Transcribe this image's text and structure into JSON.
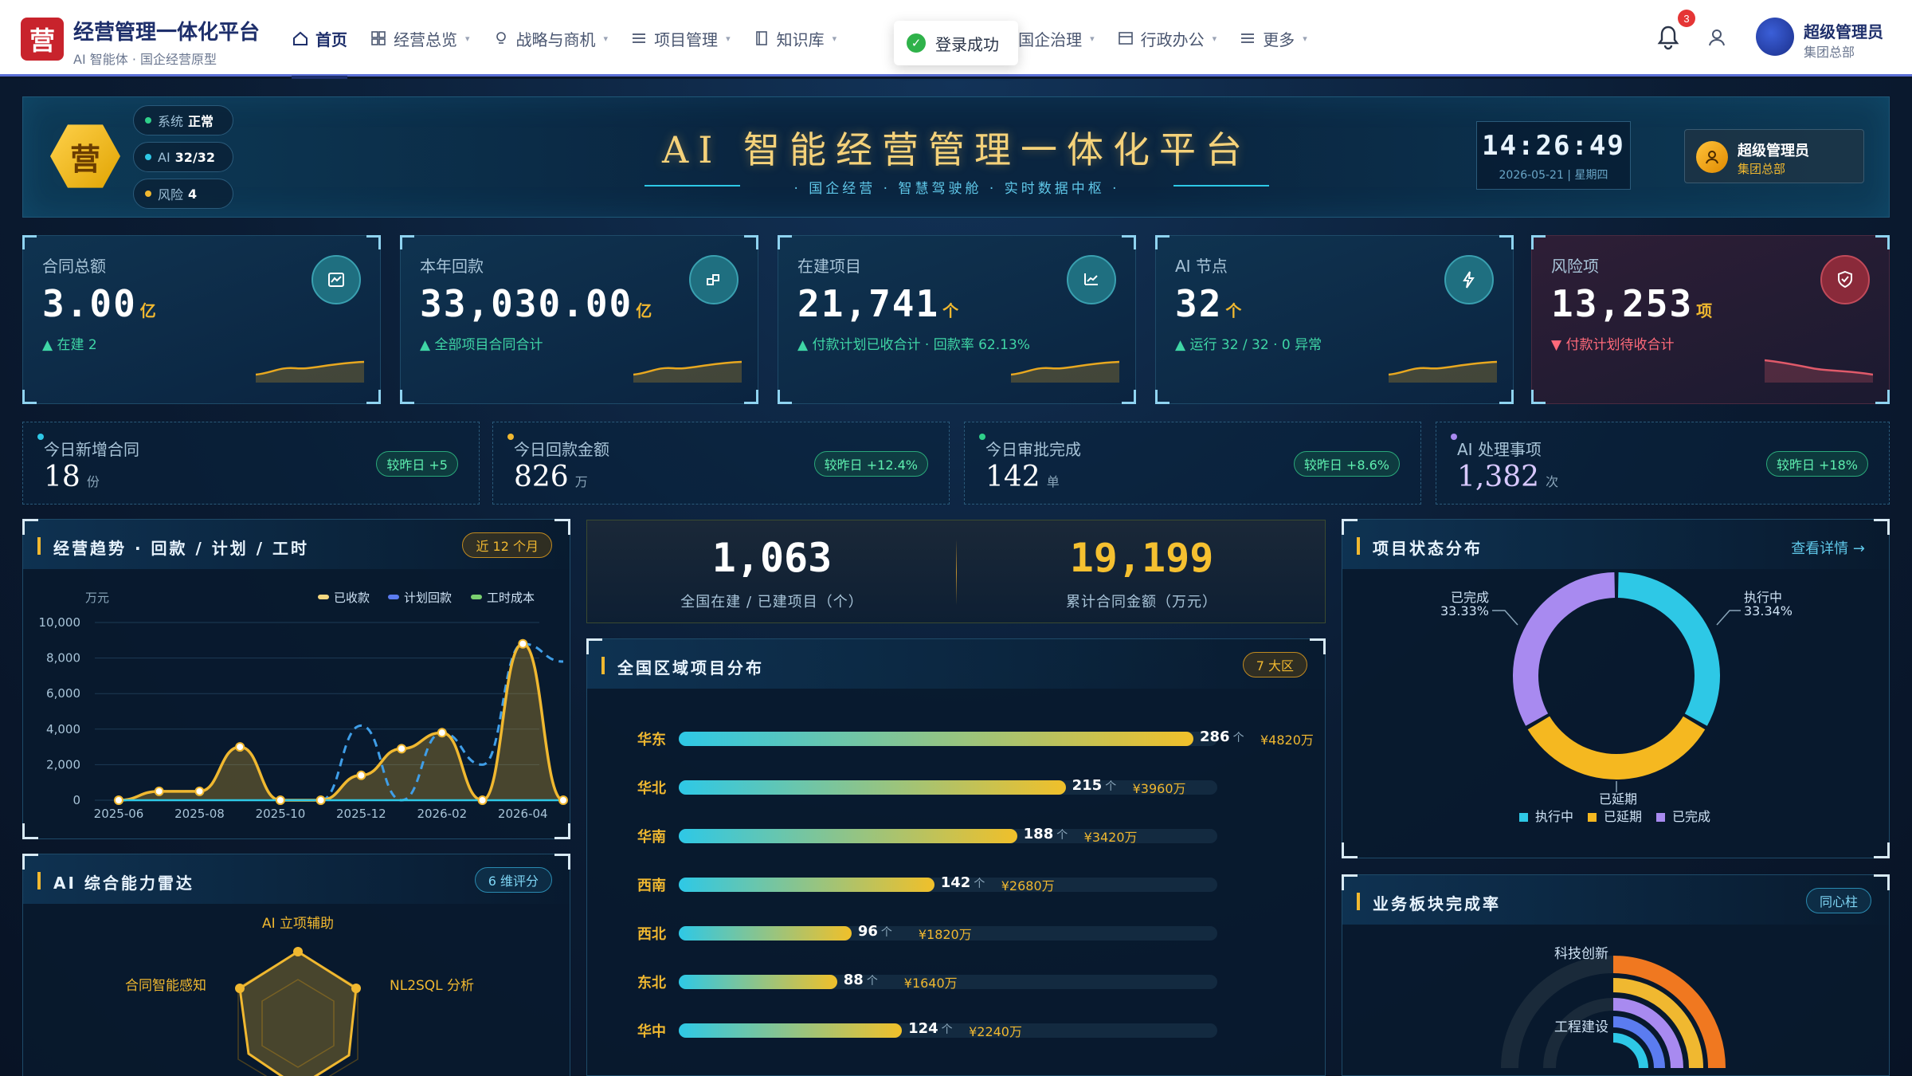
{
  "header": {
    "logo_char": "营",
    "title": "经营管理一体化平台",
    "subtitle": "AI 智能体 · 国企经营原型",
    "nav": [
      {
        "label": "首页",
        "active": true,
        "icon": "home-icon"
      },
      {
        "label": "经营总览",
        "icon": "grid-icon"
      },
      {
        "label": "战略与商机",
        "icon": "bulb-icon"
      },
      {
        "label": "项目管理",
        "icon": "list-icon"
      },
      {
        "label": "知识库",
        "icon": "book-icon"
      },
      {
        "label": "国企治理",
        "icon": "bank-icon"
      },
      {
        "label": "行政办公",
        "icon": "office-icon"
      },
      {
        "label": "更多",
        "icon": "menu-icon"
      }
    ],
    "toast": "登录成功",
    "notification_count": "3",
    "user_name": "超级管理员",
    "user_org": "集团总部"
  },
  "hero": {
    "emblem": "营",
    "title": "AI 智能经营管理一体化平台",
    "subtitle": "· 国企经营 · 智慧驾驶舱 · 实时数据中枢 ·",
    "pills": [
      {
        "label": "系统",
        "value": "正常",
        "color": "#2fd08a"
      },
      {
        "label": "AI",
        "value": "32/32",
        "color": "#2ec8e6"
      },
      {
        "label": "风险",
        "value": "4",
        "color": "#f0b830"
      }
    ],
    "time": "14:26:49",
    "date": "2026-05-21 | 星期四",
    "user_name": "超级管理员",
    "user_org": "集团总部"
  },
  "kpis": [
    {
      "label": "合同总额",
      "value": "3.00",
      "unit": "亿",
      "sub": "▲ 在建 2",
      "icon": "chart-icon"
    },
    {
      "label": "本年回款",
      "value": "33,030.00",
      "unit": "亿",
      "sub": "▲ 全部项目合同合计",
      "icon": "blocks-icon"
    },
    {
      "label": "在建项目",
      "value": "21,741",
      "unit": "个",
      "sub": "▲ 付款计划已收合计 · 回款率 62.13%",
      "icon": "trend-icon"
    },
    {
      "label": "AI 节点",
      "value": "32",
      "unit": "个",
      "sub": "▲ 运行 32 / 32 · 0 异常",
      "icon": "bolt-icon"
    },
    {
      "label": "风险项",
      "value": "13,253",
      "unit": "项",
      "sub": "▼ 付款计划待收合计",
      "icon": "shield-icon"
    }
  ],
  "minis": [
    {
      "label": "今日新增合同",
      "value": "18",
      "unit": "份",
      "tag": "较昨日 +5",
      "dot": "#2ec8e6"
    },
    {
      "label": "今日回款金额",
      "value": "826",
      "unit": "万",
      "tag": "较昨日 +12.4%",
      "dot": "#f0b830"
    },
    {
      "label": "今日审批完成",
      "value": "142",
      "unit": "单",
      "tag": "较昨日 +8.6%",
      "dot": "#2fd08a"
    },
    {
      "label": "AI 处理事项",
      "value": "1,382",
      "unit": "次",
      "tag": "较昨日 +18%",
      "dot": "#a88af0"
    }
  ],
  "trend_panel": {
    "title": "经营趋势 · 回款 / 计划 / 工时",
    "chip": "近 12 个月"
  },
  "radar_panel": {
    "title": "AI 综合能力雷达",
    "chip": "6 维评分",
    "axes": [
      "AI 立项辅助",
      "NL2SQL 分析",
      "合同智能感知"
    ],
    "values": [
      0.7,
      0.6,
      0.62
    ]
  },
  "big_stats": {
    "v1": "1,063",
    "l1": "全国在建 / 已建项目（个）",
    "v2": "19,199",
    "l2": "累计合同金额（万元）"
  },
  "region_panel": {
    "title": "全国区域项目分布",
    "chip": "7 大区"
  },
  "regions": [
    {
      "name": "华东",
      "count": 286,
      "unit": "个",
      "amount": "¥4820万"
    },
    {
      "name": "华北",
      "count": 215,
      "unit": "个",
      "amount": "¥3960万"
    },
    {
      "name": "华南",
      "count": 188,
      "unit": "个",
      "amount": "¥3420万"
    },
    {
      "name": "西南",
      "count": 142,
      "unit": "个",
      "amount": "¥2680万"
    },
    {
      "name": "西北",
      "count": 96,
      "unit": "个",
      "amount": "¥1820万"
    },
    {
      "name": "东北",
      "count": 88,
      "unit": "个",
      "amount": "¥1640万"
    },
    {
      "name": "华中",
      "count": 124,
      "unit": "个",
      "amount": "¥2240万"
    }
  ],
  "status_panel": {
    "title": "项目状态分布",
    "link": "查看详情 →"
  },
  "completion_panel": {
    "title": "业务板块完成率",
    "chip": "同心柱",
    "labels": [
      "科技创新",
      "工程建设"
    ]
  },
  "colors": {
    "gold": "#f0b830",
    "cyan": "#2ec8e6",
    "blue": "#5b7cf0",
    "green": "#7ad070",
    "purple": "#a88af0"
  },
  "chart_data": [
    {
      "type": "line",
      "title": "",
      "ylabel": "万元",
      "ylim": [
        0,
        10000
      ],
      "yticks": [
        "10,000",
        "8,000",
        "6,000",
        "4,000",
        "2,000",
        "0"
      ],
      "x": [
        "2025-06",
        "2025-07",
        "2025-08",
        "2025-09",
        "2025-10",
        "2025-11",
        "2025-12",
        "2026-01",
        "2026-02",
        "2026-03",
        "2026-04",
        "2026-05"
      ],
      "xtick_labels": [
        "2025-06",
        "2025-08",
        "2025-10",
        "2025-12",
        "2026-02",
        "2026-04"
      ],
      "series": [
        {
          "name": "已收款",
          "values": [
            0,
            500,
            500,
            3000,
            0,
            0,
            1400,
            2900,
            3800,
            0,
            8800,
            0
          ]
        },
        {
          "name": "计划回款",
          "values": [
            0,
            500,
            500,
            3000,
            0,
            0,
            4200,
            0,
            3800,
            2000,
            8800,
            7800
          ]
        },
        {
          "name": "工时成本",
          "values": [
            0,
            0,
            0,
            0,
            0,
            0,
            0,
            0,
            0,
            0,
            0,
            0
          ]
        }
      ],
      "legend": "top-right"
    },
    {
      "type": "pie",
      "title": "",
      "slices": [
        {
          "name": "执行中",
          "value": 33.34,
          "label": "33.34%"
        },
        {
          "name": "已延期",
          "value": 33.33,
          "label": "33.33%"
        },
        {
          "name": "已完成",
          "value": 33.33,
          "label": "33.33%"
        }
      ],
      "legend": "bottom"
    }
  ]
}
